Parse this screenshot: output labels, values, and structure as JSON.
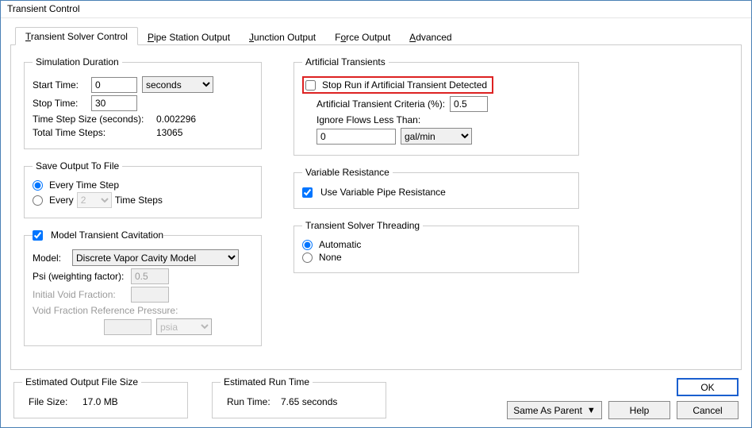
{
  "window": {
    "title": "Transient Control"
  },
  "tabs": {
    "solver": "Transient Solver Control",
    "pipe": "Pipe Station Output",
    "junction": "Junction Output",
    "force": "Force Output",
    "advanced": "Advanced"
  },
  "duration": {
    "legend": "Simulation Duration",
    "start_label": "Start Time:",
    "start_value": "0",
    "stop_label": "Stop Time:",
    "stop_value": "30",
    "unit": "seconds",
    "step_label": "Time Step Size (seconds):",
    "step_value": "0.002296",
    "total_label": "Total Time Steps:",
    "total_value": "13065"
  },
  "save": {
    "legend": "Save Output To File",
    "every_step": "Every Time Step",
    "every_label": "Every",
    "every_value": "2",
    "time_steps": "Time Steps"
  },
  "cavitation": {
    "check_label": "Model Transient Cavitation",
    "model_label": "Model:",
    "model_value": "Discrete Vapor Cavity Model",
    "psi_label": "Psi (weighting factor):",
    "psi_value": "0.5",
    "void_label": "Initial Void Fraction:",
    "refp_label": "Void Fraction Reference Pressure:",
    "refp_unit": "psia"
  },
  "artificial": {
    "legend": "Artificial Transients",
    "stop_label": "Stop Run if Artificial Transient Detected",
    "criteria_label": "Artificial Transient Criteria (%):",
    "criteria_value": "0.5",
    "ignore_label": "Ignore Flows Less Than:",
    "ignore_value": "0",
    "ignore_unit": "gal/min"
  },
  "varres": {
    "legend": "Variable Resistance",
    "use_label": "Use Variable Pipe Resistance"
  },
  "threading": {
    "legend": "Transient Solver Threading",
    "auto": "Automatic",
    "none": "None"
  },
  "footer": {
    "filesize_legend": "Estimated Output File Size",
    "filesize_label": "File Size:",
    "filesize_value": "17.0 MB",
    "runtime_legend": "Estimated Run Time",
    "runtime_label": "Run Time:",
    "runtime_value": "7.65 seconds",
    "same_as_parent": "Same As Parent",
    "help": "Help",
    "ok": "OK",
    "cancel": "Cancel"
  }
}
